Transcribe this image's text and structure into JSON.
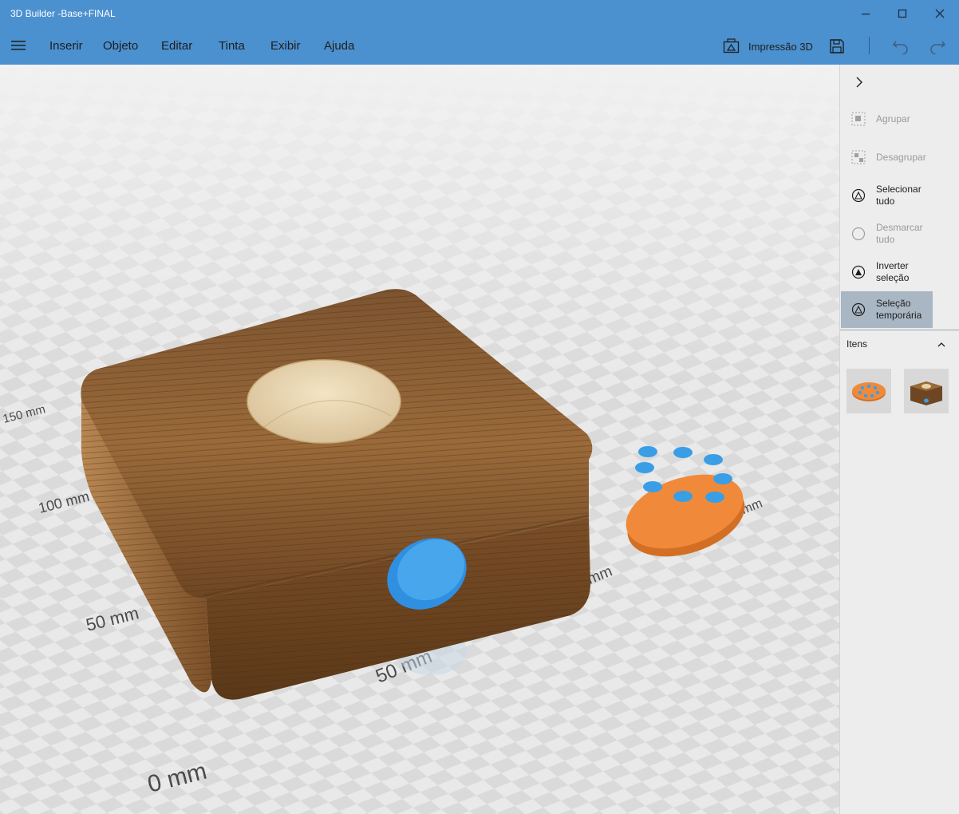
{
  "window": {
    "title": "3D Builder -Base+FINAL"
  },
  "menu": {
    "items": [
      "Inserir",
      "Objeto",
      "Editar",
      "Tinta",
      "Exibir",
      "Ajuda"
    ],
    "print3d_label": "Impressão 3D"
  },
  "viewport": {
    "axis_labels": {
      "left": [
        "0 mm",
        "50 mm",
        "100 mm",
        "150 mm"
      ],
      "bottom": [
        "50 mm",
        "100 mm",
        "150 mm"
      ]
    }
  },
  "panel": {
    "items": [
      {
        "label": "Agrupar",
        "state": "disabled",
        "icon": "group-icon"
      },
      {
        "label": "Desagrupar",
        "state": "disabled",
        "icon": "ungroup-icon"
      },
      {
        "label": "Selecionar tudo",
        "state": "enabled",
        "icon": "select-all-icon"
      },
      {
        "label": "Desmarcar tudo",
        "state": "disabled",
        "icon": "deselect-all-icon"
      },
      {
        "label": "Inverter seleção",
        "state": "enabled",
        "icon": "invert-selection-icon"
      },
      {
        "label_line1": "Seleção",
        "label_line2": "temporária",
        "state": "active",
        "icon": "temporary-selection-icon"
      }
    ],
    "items_header": "Itens",
    "thumbnails": [
      {
        "name": "orange-disc-thumbnail"
      },
      {
        "name": "wooden-box-thumbnail"
      }
    ]
  },
  "colors": {
    "titlebar": "#4b90cf",
    "accent_blue": "#3da0e6",
    "orange": "#f08a3a",
    "wood": "#8a5a2b"
  }
}
